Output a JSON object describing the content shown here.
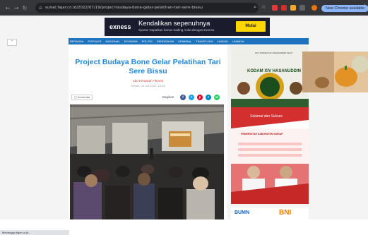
{
  "browser": {
    "url": "sulsel.fajar.co.id/2022/07/19/project-budaya-bone-gelar-pelatihan-tari-sere-bissu/",
    "new_chrome_label": "New Chrome available",
    "back_icon": "arrow-left-icon",
    "forward_icon": "arrow-right-icon",
    "reload_icon": "reload-icon"
  },
  "ad_banner": {
    "brand": "exness",
    "title": "Kendalikan sepenuhnya",
    "subtitle": "Syarat: Dapatkan bonus trading Anda dengan Exness.",
    "cta": "Mulai"
  },
  "nav": {
    "items": [
      "BERANDA",
      "POPULER",
      "NASIONAL",
      "EKONOMI",
      "POLITIK",
      "PENDIDIKAN",
      "KRIMINAL",
      "TRAVELLING",
      "HUKUM",
      "LAINNYA"
    ]
  },
  "article": {
    "headline": "Project Budaya Bone Gelar Pelatihan Tari Sere Bissu",
    "author": "Abd Himawan • Event",
    "date": "Selasa, 19 Juli 2022, 19:38",
    "comment_label": "Komentar",
    "share_label": "Bagikan",
    "share_icons": [
      "f",
      "t",
      "p",
      "t",
      "w"
    ]
  },
  "side_ads": {
    "kodam_top": "HUT KODAM XIV HASANUDDIN KE-67",
    "kodam_title": "KODAM XIV HASANUDDIN",
    "pemda_greeting": "Selamat dan Sukses",
    "pemda_org": "PEMERINTAH KABUPATEN SIDRAP",
    "bumn_label": "BUMN",
    "bni_label": "BNI"
  },
  "status": {
    "text": "Menunggu fajar.co.id..."
  },
  "colors": {
    "chrome_bg": "#35363a",
    "nav_blue": "#1e73be",
    "headline_blue": "#1e88e5",
    "ad_yellow": "#ffd600",
    "kodam_green": "#1b4d1e",
    "pemda_red": "#d32f2f"
  }
}
